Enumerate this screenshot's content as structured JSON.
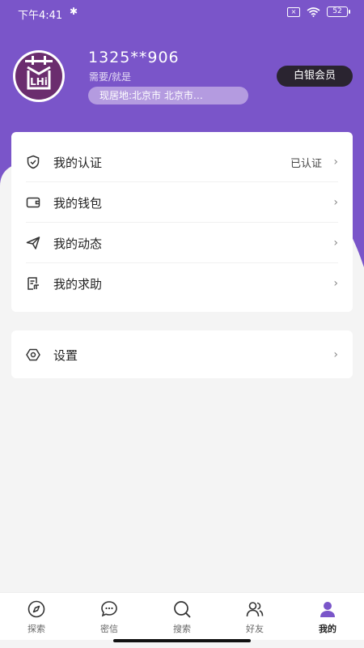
{
  "status": {
    "time": "下午4:41",
    "battery": "52"
  },
  "profile": {
    "username": "1325**906",
    "subtitle": "需要/就是",
    "location": "现居地:北京市  北京市…",
    "member_badge": "白银会员",
    "avatar_text": "LHi"
  },
  "menu": {
    "items": [
      {
        "label": "我的认证",
        "value": "已认证",
        "icon": "shield-check-icon"
      },
      {
        "label": "我的钱包",
        "value": "",
        "icon": "wallet-icon"
      },
      {
        "label": "我的动态",
        "value": "",
        "icon": "paper-plane-icon"
      },
      {
        "label": "我的求助",
        "value": "",
        "icon": "document-icon"
      }
    ],
    "settings": {
      "label": "设置",
      "icon": "settings-icon"
    }
  },
  "tabs": [
    {
      "label": "探索",
      "icon": "compass-icon"
    },
    {
      "label": "密信",
      "icon": "chat-icon"
    },
    {
      "label": "搜索",
      "icon": "search-icon"
    },
    {
      "label": "好友",
      "icon": "friends-icon"
    },
    {
      "label": "我的",
      "icon": "profile-icon"
    }
  ],
  "colors": {
    "brand": "#7a55c9",
    "location_pill": "#b49be0",
    "member_badge_bg": "#2a2430"
  }
}
